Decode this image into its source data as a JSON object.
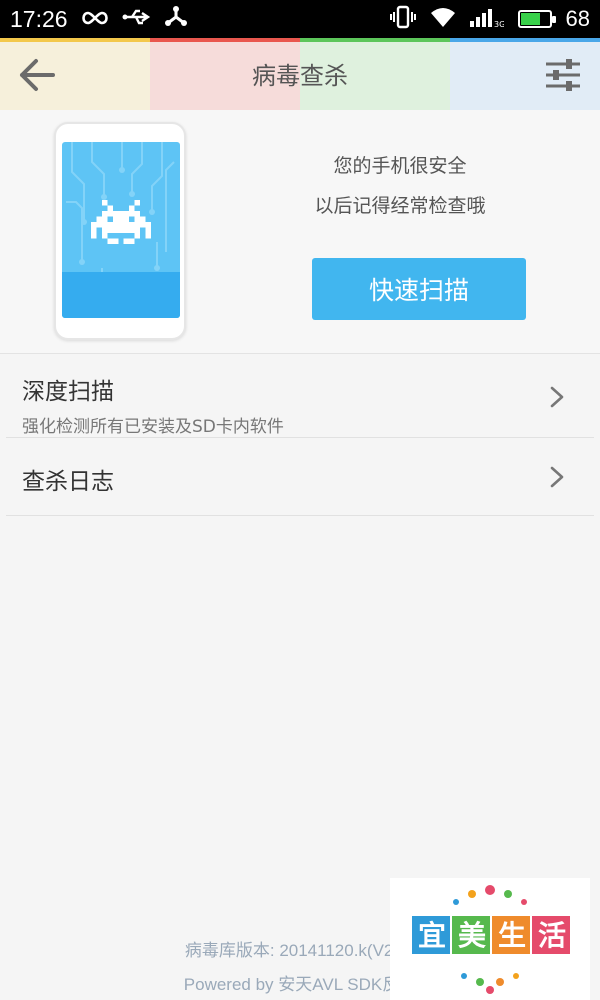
{
  "status_bar": {
    "time": "17:26",
    "battery_level": 68,
    "battery_text": "68",
    "network": "3G",
    "icons": [
      "infinity-icon",
      "usb-icon",
      "share-icon",
      "vibrate-icon",
      "wifi-icon",
      "signal-icon",
      "battery-icon"
    ]
  },
  "header": {
    "title": "病毒查杀",
    "stripe_colors": [
      "#f3c84b",
      "#e9574e",
      "#5cc65a",
      "#4aa7e8"
    ],
    "background_colors": [
      "#f6efd8",
      "#f6d9d7",
      "#ddf1dc",
      "#dfebf6"
    ]
  },
  "hero": {
    "status_line1": "您的手机很安全",
    "status_line2": "以后记得经常检查哦",
    "scan_button": "快速扫描",
    "accent": "#41b6ef"
  },
  "list": {
    "items": [
      {
        "title": "深度扫描",
        "subtitle": "强化检测所有已安装及SD卡内软件"
      },
      {
        "title": "查杀日志",
        "subtitle": ""
      }
    ]
  },
  "footer": {
    "db_version": "病毒库版本: 20141120.k(V2 (B",
    "powered_by": "Powered by 安天AVL SDK反病"
  },
  "watermark": {
    "text": "宜美生活",
    "colors": [
      "#2e9ad8",
      "#56b94d",
      "#ef8b2c",
      "#e54b6b"
    ]
  }
}
